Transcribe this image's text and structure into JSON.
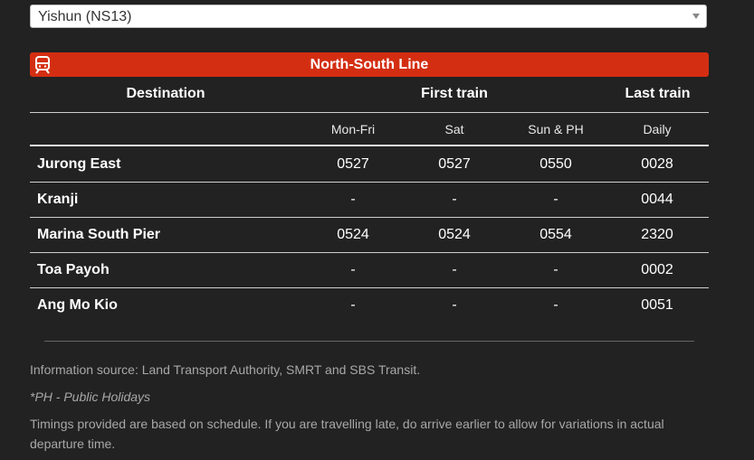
{
  "station_select": {
    "value": "Yishun (NS13)"
  },
  "line": {
    "name": "North-South Line",
    "color": "#d42e12",
    "icon": "train-icon"
  },
  "table": {
    "headers": {
      "destination": "Destination",
      "first_train": "First train",
      "last_train": "Last train"
    },
    "subheaders": [
      "Mon-Fri",
      "Sat",
      "Sun & PH",
      "Daily"
    ],
    "rows": [
      {
        "destination": "Jurong East",
        "times": [
          "0527",
          "0527",
          "0550",
          "0028"
        ]
      },
      {
        "destination": "Kranji",
        "times": [
          "-",
          "-",
          "-",
          "0044"
        ]
      },
      {
        "destination": "Marina South Pier",
        "times": [
          "0524",
          "0524",
          "0554",
          "2320"
        ]
      },
      {
        "destination": "Toa Payoh",
        "times": [
          "-",
          "-",
          "-",
          "0002"
        ]
      },
      {
        "destination": "Ang Mo Kio",
        "times": [
          "-",
          "-",
          "-",
          "0051"
        ]
      }
    ]
  },
  "notes": {
    "source": "Information source: Land Transport Authority, SMRT and SBS Transit.",
    "ph": "*PH - Public Holidays",
    "disclaimer": "Timings provided are based on schedule. If you are travelling late, do arrive earlier to allow for variations in actual departure time."
  }
}
